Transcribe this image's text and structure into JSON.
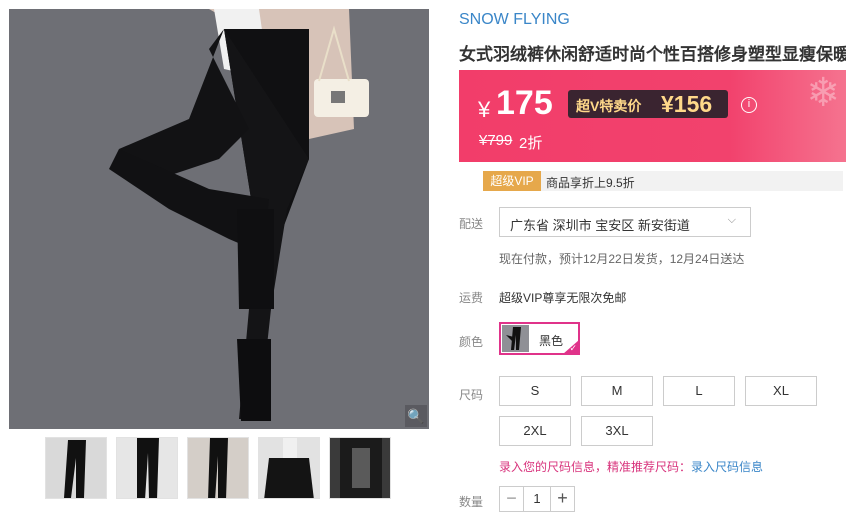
{
  "brand": "SNOW FLYING",
  "title": "女式羽绒裤休闲舒适时尚个性百搭修身塑型显瘦保暖鹅绒裤",
  "price": {
    "currency": "¥",
    "value": "175",
    "vip_label": "超V特卖价",
    "vip_price": "¥156",
    "original": "¥799",
    "discount": "2折"
  },
  "vip": {
    "badge": "超级VIP",
    "text": "商品享折上9.5折"
  },
  "delivery": {
    "label": "配送",
    "address": "广东省 深圳市 宝安区 新安街道",
    "note": "现在付款，预计12月22日发货，12月24日送达"
  },
  "freight": {
    "label": "运费",
    "text": "超级VIP尊享无限次免邮"
  },
  "color": {
    "label": "颜色",
    "options": [
      {
        "name": "黑色",
        "selected": true
      }
    ]
  },
  "size": {
    "label": "尺码",
    "options": [
      "S",
      "M",
      "L",
      "XL",
      "2XL",
      "3XL"
    ],
    "hint": "录入您的尺码信息，精准推荐尺码：",
    "hint_link": "录入尺码信息"
  },
  "quantity": {
    "label": "数量",
    "value": "1",
    "minus": "−",
    "plus": "+"
  },
  "icons": {
    "zoom": "zoom-icon",
    "info": "info-icon",
    "chevron": "chevron-down-icon"
  },
  "colors": {
    "accent": "#f23d6a",
    "brand": "#3a86c8",
    "selected": "#e0338a",
    "vip": "#e6a84b"
  }
}
